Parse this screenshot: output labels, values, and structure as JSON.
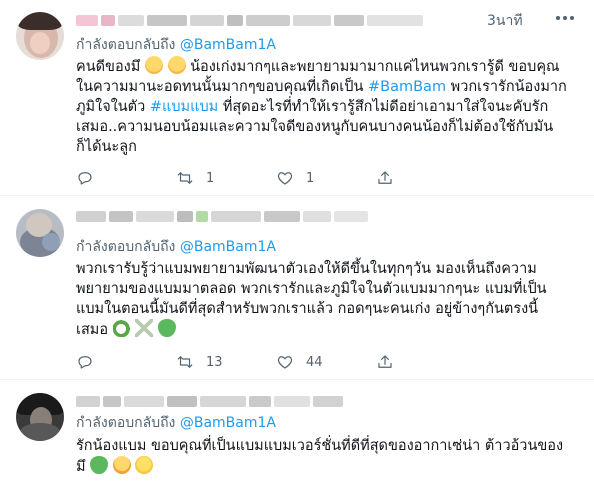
{
  "tweets": [
    {
      "time": "3นาที",
      "replying_prefix": "กำลังตอบกลับถึง",
      "replying_handle": "@BamBam1A",
      "lines": {
        "l1a": "คนดีของมึ",
        "l1b": " น้องเก่งมากๆและพยายามมามากแค่ไหนพวกเรารู้ดี ขอบคุณ",
        "l2a": "ในความมานะอดทนนั้นมากๆขอบคุณที่เกิดเป็น ",
        "l2link": "#BamBam",
        "l2b": " พวกเรารักน้องมาก",
        "l3a": "ภูมิใจในตัว ",
        "l3link": "#แบมแบม",
        "l3b": " ที่สุดอะไรที่ทำให้เรารู้สึกไม่ดีอย่าเอามาใส่ใจนะคับรัก",
        "l4": "เสมอ..ความนอบน้อมและความใจดีของหนูกับคนบางคนน้องก็ไม่ต้องใช้กับมัน",
        "l5": "ก็ได้นะลูก"
      },
      "retweets": "1",
      "likes": "1",
      "emoji": [
        "relieved-face-emoji",
        "relieved-face-emoji"
      ]
    },
    {
      "replying_prefix": "กำลังตอบกลับถึง",
      "replying_handle": "@BamBam1A",
      "lines": {
        "l1": "พวกเรารับรู้ว่าแบมพยายามพัฒนาตัวเองให้ดีขึ้นในทุกๆวัน มองเห็นถึงความ",
        "l2": "พยายามของแบมมาตลอด พวกเรารักและภูมิใจในตัวแบมมากๆนะ แบมที่เป็น",
        "l3": "แบมในตอนนี้มันดีที่สุดสำหรับพวกเราแล้ว กอดๆนะคนเก่ง อยู่ข้างๆกันตรงนี้",
        "l4": "เสมอ"
      },
      "retweets": "13",
      "likes": "44",
      "emoji": [
        "snake-emoji",
        "sparkle-emoji",
        "green-heart-emoji"
      ]
    },
    {
      "replying_prefix": "กำลังตอบกลับถึง",
      "replying_handle": "@BamBam1A",
      "lines": {
        "l1": "รักน้องแบม ขอบคุณที่เป็นแบมแบมเวอร์ชั่นที่ดีที่สุดของอากาเซ่น่า ต้าวอ้วนของ",
        "l2": "มึ"
      },
      "emoji": [
        "green-heart-emoji",
        "hugging-face-emoji",
        "baby-chick-emoji"
      ]
    }
  ],
  "colors": {
    "link": "#1d9bf0",
    "muted": "#536471",
    "text": "#0f1419",
    "divider": "#eff3f4"
  }
}
